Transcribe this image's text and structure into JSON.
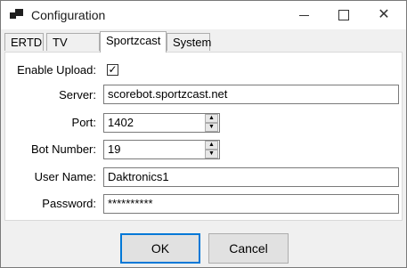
{
  "window": {
    "title": "Configuration"
  },
  "tabs": [
    "ERTD",
    "TV Feed",
    "Sportzcast",
    "System"
  ],
  "active_tab": "Sportzcast",
  "form": {
    "enable_upload_label": "Enable Upload:",
    "enable_upload_checked": true,
    "server_label": "Server:",
    "server_value": "scorebot.sportzcast.net",
    "port_label": "Port:",
    "port_value": "1402",
    "bot_number_label": "Bot Number:",
    "bot_number_value": "19",
    "user_name_label": "User Name:",
    "user_name_value": "Daktronics1",
    "password_label": "Password:",
    "password_value": "**********"
  },
  "buttons": {
    "ok": "OK",
    "cancel": "Cancel"
  },
  "caption_buttons": {
    "close_glyph": "✕"
  },
  "icons": [
    "app-icon",
    "minimize-icon",
    "maximize-icon",
    "close-icon",
    "checkmark-icon",
    "spin-up-icon",
    "spin-down-icon"
  ]
}
